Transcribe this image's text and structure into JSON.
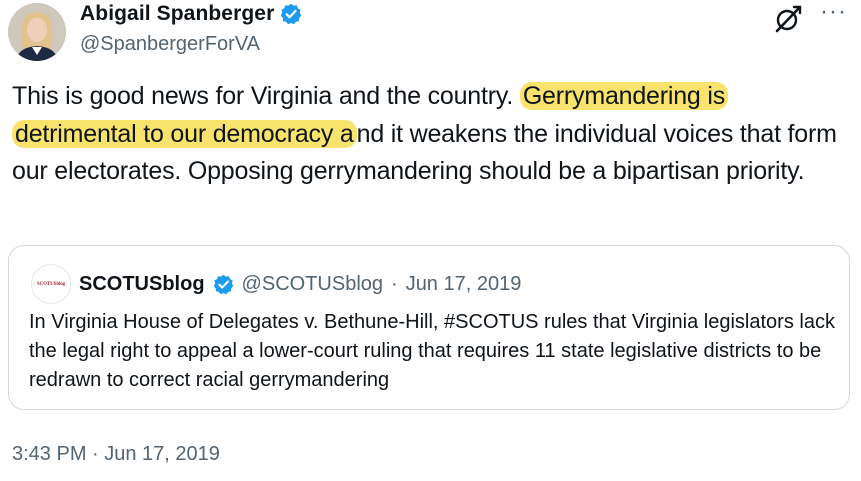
{
  "author": {
    "display_name": "Abigail Spanberger",
    "handle": "@SpanbergerForVA",
    "verified": true
  },
  "tweet": {
    "text_part1": "This is good news for Virginia and the country. ",
    "highlight_part1": "Gerrymandering is",
    "highlight_part2": "detrimental to our democracy a",
    "text_part2": "nd it weakens the individual voices that form our electorates. Opposing gerrymandering should be a bipartisan priority.",
    "highlight_color": "#f8e36c"
  },
  "quoted_tweet": {
    "display_name": "SCOTUSblog",
    "handle": "@SCOTUSblog",
    "separator": "·",
    "date": "Jun 17, 2019",
    "text": "In Virginia House of Delegates v. Bethune-Hill, #SCOTUS rules that Virginia legislators lack the legal right to appeal a lower-court ruling that requires 11 state legislative districts to be redrawn to correct racial gerrymandering",
    "logo_text": "SCOTUSblog",
    "verified": true
  },
  "timestamp": "3:43 PM · Jun 17, 2019",
  "icons": {
    "verified": "verified-badge-icon",
    "grok": "grok-icon",
    "more": "more-options-icon"
  },
  "colors": {
    "verified_blue": "#1d9bf0",
    "secondary_text": "#536471",
    "border": "#cfd9de"
  }
}
